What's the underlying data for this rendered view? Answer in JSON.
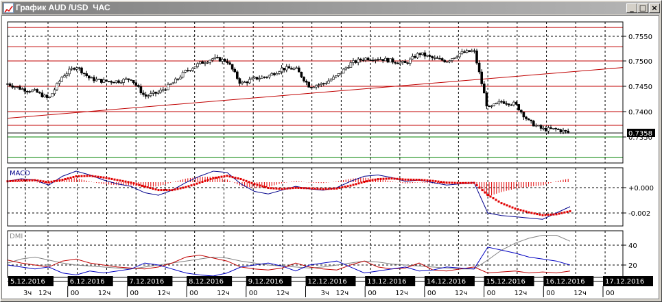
{
  "window": {
    "title": "График AUD /USD  ЧАС",
    "buttons": {
      "minimize": "_",
      "maximize": "□",
      "close": "×"
    }
  },
  "colors": {
    "bull": "#000000",
    "level": "#c00000",
    "support": "#008000",
    "macd": "#00008b",
    "signal": "#e00000",
    "adx": "#808080",
    "plus_di": "#c00000",
    "minus_di": "#0000c0"
  },
  "chart_data": [
    {
      "type": "candlestick",
      "title": "AUD/USD H1",
      "ylim": [
        0.7315,
        0.758
      ],
      "y_ticks": [
        "0.7550",
        "0.7500",
        "0.7450",
        "0.7400",
        "0.7350"
      ],
      "y_tick_values": [
        0.755,
        0.75,
        0.745,
        0.74,
        0.735
      ],
      "current_price_label": "0.7358",
      "current_price": 0.7358,
      "red_levels": [
        0.7566,
        0.7528,
        0.75,
        0.745,
        0.74,
        0.7373
      ],
      "green_levels": [
        0.735,
        0.731
      ],
      "trendline": [
        0.7387,
        0.7487
      ],
      "close_series": [
        0.7455,
        0.7445,
        0.744,
        0.7425,
        0.747,
        0.749,
        0.7465,
        0.746,
        0.746,
        0.7465,
        0.743,
        0.7438,
        0.7455,
        0.748,
        0.7495,
        0.7505,
        0.75,
        0.7455,
        0.7465,
        0.747,
        0.7485,
        0.7485,
        0.745,
        0.7455,
        0.747,
        0.7495,
        0.7505,
        0.7505,
        0.75,
        0.7495,
        0.7515,
        0.7505,
        0.75,
        0.7515,
        0.752,
        0.7405,
        0.742,
        0.7415,
        0.738,
        0.7365,
        0.7365,
        0.7358
      ]
    },
    {
      "type": "line",
      "title": "MACD",
      "ylim": [
        -0.003,
        0.0016
      ],
      "y_ticks": [
        "+0.000",
        "-0.002"
      ],
      "y_tick_values": [
        0,
        -0.002
      ],
      "macd": [
        0.0005,
        0.0007,
        0.0006,
        0.0002,
        0.0009,
        0.0013,
        0.001,
        0.0006,
        0.0003,
        0.0001,
        -0.0004,
        -0.0006,
        -0.0002,
        0.0004,
        0.0009,
        0.0013,
        0.0012,
        0.0003,
        -0.0003,
        -0.0005,
        -0.0002,
        0.0001,
        -0.0001,
        -0.0002,
        0.0,
        0.0005,
        0.0009,
        0.001,
        0.0008,
        0.0005,
        0.0006,
        0.0004,
        0.0002,
        0.0003,
        0.0004,
        -0.002,
        -0.0022,
        -0.0023,
        -0.0024,
        -0.0025,
        -0.002,
        -0.0015
      ]
    },
    {
      "type": "line",
      "title": "DMI",
      "ylim": [
        0,
        56
      ],
      "y_ticks": [
        "40",
        "20"
      ],
      "y_tick_values": [
        40,
        20
      ],
      "adx": [
        22,
        26,
        28,
        25,
        22,
        20,
        19,
        18,
        17,
        16,
        18,
        20,
        22,
        24,
        26,
        28,
        27,
        24,
        22,
        20,
        19,
        18,
        17,
        18,
        20,
        22,
        24,
        23,
        21,
        20,
        19,
        18,
        17,
        16,
        16,
        25,
        35,
        42,
        47,
        50,
        50,
        44
      ],
      "plus_di": [
        25,
        22,
        20,
        18,
        24,
        26,
        22,
        20,
        18,
        17,
        16,
        18,
        22,
        28,
        30,
        27,
        24,
        18,
        16,
        15,
        17,
        22,
        18,
        16,
        15,
        20,
        24,
        18,
        16,
        17,
        22,
        15,
        14,
        16,
        18,
        12,
        13,
        14,
        12,
        13,
        12,
        14
      ],
      "minus_di": [
        20,
        18,
        16,
        18,
        12,
        10,
        14,
        12,
        14,
        16,
        22,
        20,
        16,
        12,
        10,
        9,
        12,
        18,
        20,
        22,
        19,
        14,
        20,
        22,
        24,
        18,
        12,
        14,
        16,
        18,
        14,
        15,
        18,
        17,
        16,
        38,
        35,
        32,
        28,
        26,
        24,
        20
      ]
    }
  ],
  "time_axis": {
    "days": [
      {
        "date": "5.12.2016",
        "h1": "3ч",
        "h2": "12ч"
      },
      {
        "date": "6.12.2016",
        "h1": "00",
        "h2": "12ч"
      },
      {
        "date": "7.12.2016",
        "h1": "00",
        "h2": "12ч"
      },
      {
        "date": "8.12.2016",
        "h1": "00",
        "h2": "12ч"
      },
      {
        "date": "9.12.2016",
        "h1": "00",
        "h2": "12ч"
      },
      {
        "date": "12.12.2016",
        "h1": "3ч",
        "h2": "12ч"
      },
      {
        "date": "13.12.2016",
        "h1": "00",
        "h2": "12ч"
      },
      {
        "date": "14.12.2016",
        "h1": "00",
        "h2": "12ч"
      },
      {
        "date": "15.12.2016",
        "h1": "00",
        "h2": "12ч"
      },
      {
        "date": "16.12.2016",
        "h1": "00",
        "h2": "12ч"
      },
      {
        "date": "17.12.2016",
        "h1": "00",
        "h2": ""
      }
    ]
  }
}
